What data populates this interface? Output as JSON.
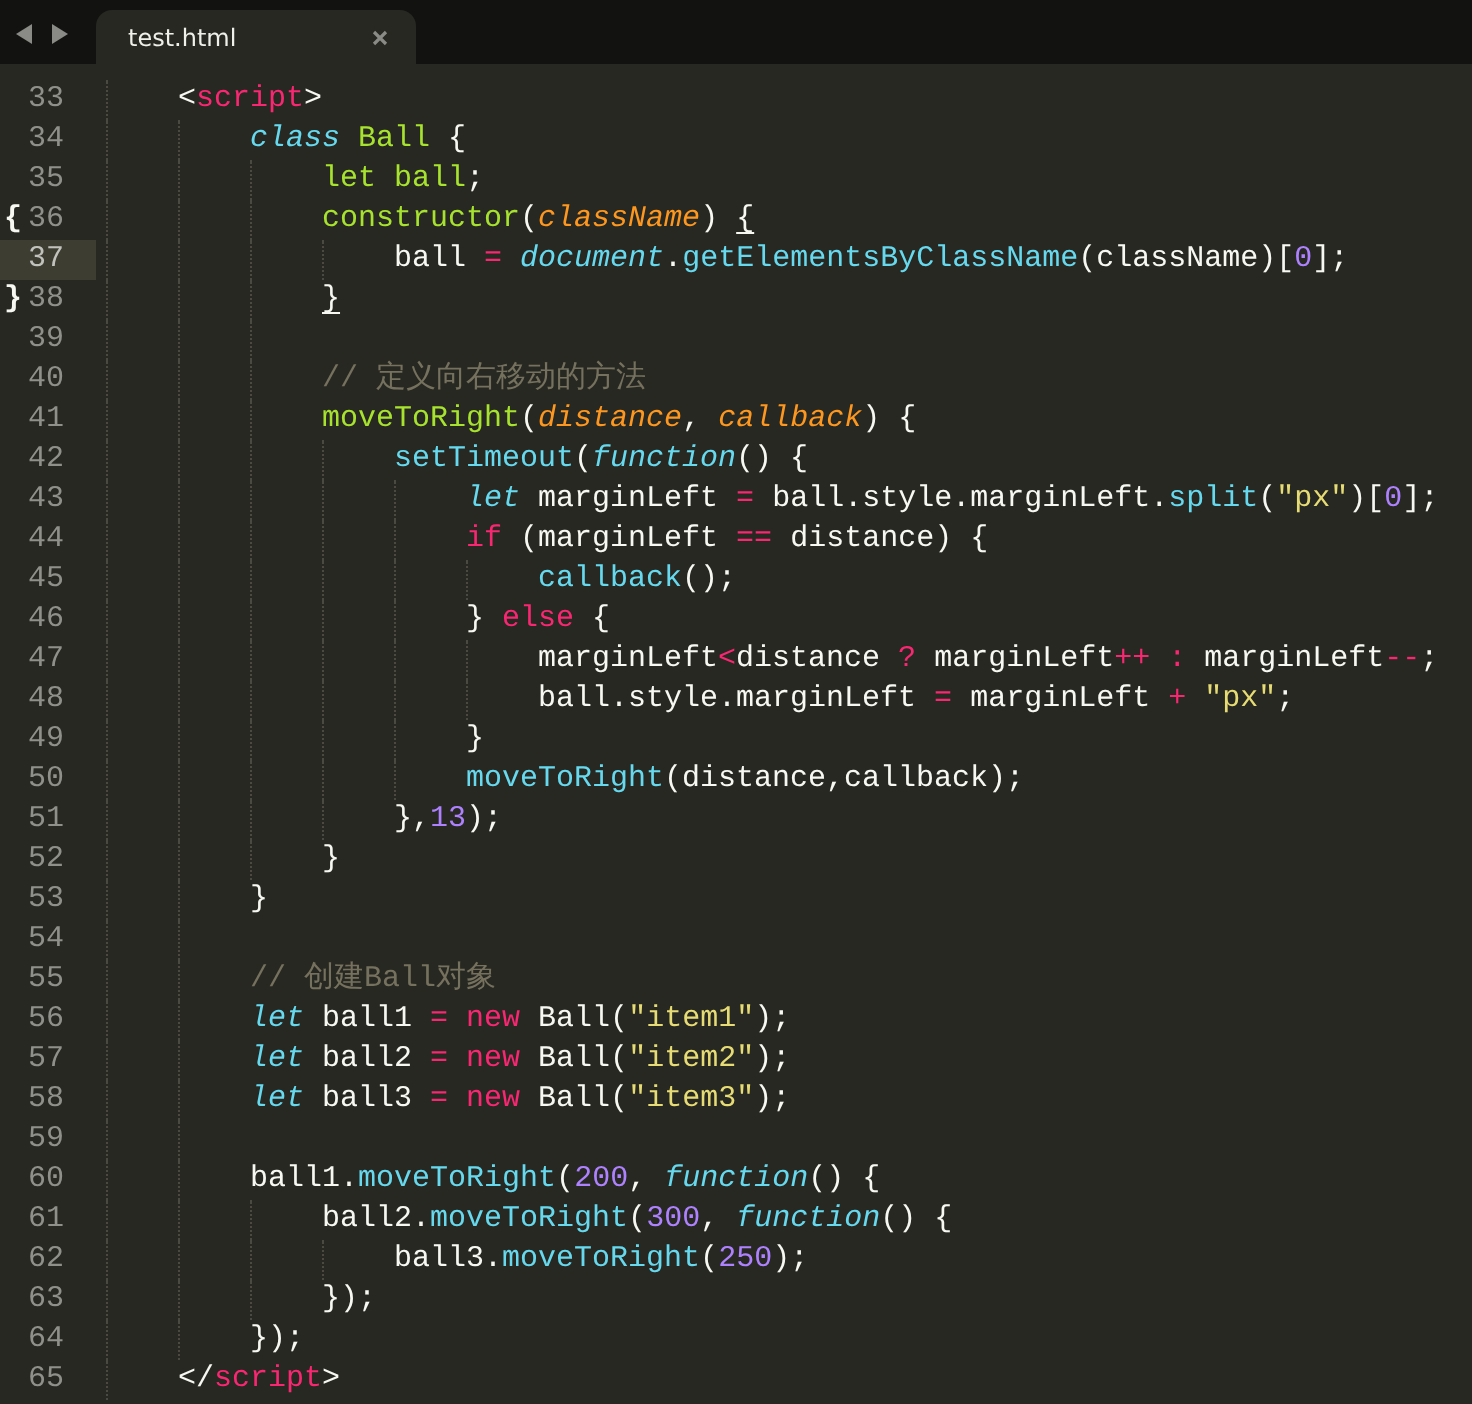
{
  "tabs": [
    {
      "label": "test.html",
      "selected": true
    }
  ],
  "lines": [
    {
      "number": "33",
      "current": false,
      "tokens": [
        {
          "kind": "plain",
          "text": "<"
        },
        {
          "kind": "keyword",
          "text": "script"
        },
        {
          "kind": "plain",
          "text": ">"
        }
      ],
      "children": [
        {
          "number": "34",
          "current": false,
          "tokens": [
            {
              "kind": "storage",
              "text": "class "
            },
            {
              "kind": "entity",
              "text": "Ball"
            },
            {
              "kind": "plain",
              "text": " {"
            }
          ],
          "children": [
            {
              "number": "35",
              "current": false,
              "tokens": [
                {
                  "kind": "entity",
                  "text": "let ball"
                },
                {
                  "kind": "plain",
                  "text": ";"
                }
              ]
            },
            {
              "number": "36",
              "current": false,
              "gutter_mark": "{",
              "tokens": [
                {
                  "kind": "entity",
                  "text": "constructor"
                },
                {
                  "kind": "plain",
                  "text": "("
                },
                {
                  "kind": "param",
                  "text": "className"
                },
                {
                  "kind": "plain",
                  "text": ") "
                },
                {
                  "kind": "plain",
                  "text": "{",
                  "matched": true
                }
              ],
              "children": [
                {
                  "number": "37",
                  "current": true,
                  "tokens": [
                    {
                      "kind": "plain",
                      "text": "ball "
                    },
                    {
                      "kind": "keyword",
                      "text": "= "
                    },
                    {
                      "kind": "storage",
                      "text": "document"
                    },
                    {
                      "kind": "plain",
                      "text": "."
                    },
                    {
                      "kind": "support",
                      "text": "getElementsByClassName"
                    },
                    {
                      "kind": "plain",
                      "text": "(className)["
                    },
                    {
                      "kind": "number",
                      "text": "0"
                    },
                    {
                      "kind": "plain",
                      "text": "];"
                    }
                  ]
                }
              ]
            },
            {
              "number": "38",
              "current": false,
              "gutter_mark": "}",
              "tokens": [
                {
                  "kind": "plain",
                  "text": "}",
                  "matched": true
                }
              ]
            },
            {
              "number": "39",
              "current": false
            },
            {
              "number": "40",
              "current": false,
              "tokens": [
                {
                  "kind": "comment",
                  "text": "// 定义向右移动的方法"
                }
              ]
            },
            {
              "number": "41",
              "current": false,
              "tokens": [
                {
                  "kind": "entity",
                  "text": "moveToRight"
                },
                {
                  "kind": "plain",
                  "text": "("
                },
                {
                  "kind": "param",
                  "text": "distance"
                },
                {
                  "kind": "plain",
                  "text": ", "
                },
                {
                  "kind": "param",
                  "text": "callback"
                },
                {
                  "kind": "plain",
                  "text": ") {"
                }
              ],
              "children": [
                {
                  "number": "42",
                  "current": false,
                  "tokens": [
                    {
                      "kind": "support",
                      "text": "setTimeout"
                    },
                    {
                      "kind": "plain",
                      "text": "("
                    },
                    {
                      "kind": "storage",
                      "text": "function"
                    },
                    {
                      "kind": "plain",
                      "text": "() {"
                    }
                  ],
                  "children": [
                    {
                      "number": "43",
                      "current": false,
                      "tokens": [
                        {
                          "kind": "storage",
                          "text": "let"
                        },
                        {
                          "kind": "plain",
                          "text": " marginLeft "
                        },
                        {
                          "kind": "keyword",
                          "text": "="
                        },
                        {
                          "kind": "plain",
                          "text": " ball.style.marginLeft."
                        },
                        {
                          "kind": "support",
                          "text": "split"
                        },
                        {
                          "kind": "plain",
                          "text": "("
                        },
                        {
                          "kind": "string",
                          "text": "\"px\""
                        },
                        {
                          "kind": "plain",
                          "text": ")["
                        },
                        {
                          "kind": "number",
                          "text": "0"
                        },
                        {
                          "kind": "plain",
                          "text": "];"
                        }
                      ]
                    },
                    {
                      "number": "44",
                      "current": false,
                      "tokens": [
                        {
                          "kind": "keyword",
                          "text": "if"
                        },
                        {
                          "kind": "plain",
                          "text": " (marginLeft "
                        },
                        {
                          "kind": "keyword",
                          "text": "=="
                        },
                        {
                          "kind": "plain",
                          "text": " distance) {"
                        }
                      ],
                      "children": [
                        {
                          "number": "45",
                          "current": false,
                          "tokens": [
                            {
                              "kind": "support",
                              "text": "callback"
                            },
                            {
                              "kind": "plain",
                              "text": "();"
                            }
                          ]
                        }
                      ]
                    },
                    {
                      "number": "46",
                      "current": false,
                      "tokens": [
                        {
                          "kind": "plain",
                          "text": "} "
                        },
                        {
                          "kind": "keyword",
                          "text": "else"
                        },
                        {
                          "kind": "plain",
                          "text": " {"
                        }
                      ],
                      "children": [
                        {
                          "number": "47",
                          "current": false,
                          "tokens": [
                            {
                              "kind": "plain",
                              "text": "marginLeft"
                            },
                            {
                              "kind": "keyword",
                              "text": "<"
                            },
                            {
                              "kind": "plain",
                              "text": "distance "
                            },
                            {
                              "kind": "keyword",
                              "text": "?"
                            },
                            {
                              "kind": "plain",
                              "text": " marginLeft"
                            },
                            {
                              "kind": "keyword",
                              "text": "++ :"
                            },
                            {
                              "kind": "plain",
                              "text": " marginLeft"
                            },
                            {
                              "kind": "keyword",
                              "text": "--"
                            },
                            {
                              "kind": "plain",
                              "text": ";"
                            }
                          ]
                        },
                        {
                          "number": "48",
                          "current": false,
                          "tokens": [
                            {
                              "kind": "plain",
                              "text": "ball.style.marginLeft "
                            },
                            {
                              "kind": "keyword",
                              "text": "="
                            },
                            {
                              "kind": "plain",
                              "text": " marginLeft "
                            },
                            {
                              "kind": "keyword",
                              "text": "+ "
                            },
                            {
                              "kind": "string",
                              "text": "\"px\""
                            },
                            {
                              "kind": "plain",
                              "text": ";"
                            }
                          ]
                        }
                      ]
                    },
                    {
                      "number": "49",
                      "current": false,
                      "tokens": [
                        {
                          "kind": "plain",
                          "text": "}"
                        }
                      ]
                    },
                    {
                      "number": "50",
                      "current": false,
                      "tokens": [
                        {
                          "kind": "support",
                          "text": "moveToRight"
                        },
                        {
                          "kind": "plain",
                          "text": "(distance,callback);"
                        }
                      ]
                    }
                  ]
                },
                {
                  "number": "51",
                  "current": false,
                  "tokens": [
                    {
                      "kind": "plain",
                      "text": "},"
                    },
                    {
                      "kind": "number",
                      "text": "13"
                    },
                    {
                      "kind": "plain",
                      "text": ");"
                    }
                  ]
                }
              ]
            },
            {
              "number": "52",
              "current": false,
              "tokens": [
                {
                  "kind": "plain",
                  "text": "}"
                }
              ]
            }
          ]
        },
        {
          "number": "53",
          "current": false,
          "tokens": [
            {
              "kind": "plain",
              "text": "}"
            }
          ]
        },
        {
          "number": "54",
          "current": false
        },
        {
          "number": "55",
          "current": false,
          "tokens": [
            {
              "kind": "comment",
              "text": "// 创建Ball对象"
            }
          ]
        },
        {
          "number": "56",
          "current": false,
          "tokens": [
            {
              "kind": "storage",
              "text": "let"
            },
            {
              "kind": "plain",
              "text": " ball1 "
            },
            {
              "kind": "keyword",
              "text": "= new"
            },
            {
              "kind": "plain",
              "text": " Ball("
            },
            {
              "kind": "string",
              "text": "\"item1\""
            },
            {
              "kind": "plain",
              "text": ");"
            }
          ]
        },
        {
          "number": "57",
          "current": false,
          "tokens": [
            {
              "kind": "storage",
              "text": "let"
            },
            {
              "kind": "plain",
              "text": " ball2 "
            },
            {
              "kind": "keyword",
              "text": "= new"
            },
            {
              "kind": "plain",
              "text": " Ball("
            },
            {
              "kind": "string",
              "text": "\"item2\""
            },
            {
              "kind": "plain",
              "text": ");"
            }
          ]
        },
        {
          "number": "58",
          "current": false,
          "tokens": [
            {
              "kind": "storage",
              "text": "let"
            },
            {
              "kind": "plain",
              "text": " ball3 "
            },
            {
              "kind": "keyword",
              "text": "= new"
            },
            {
              "kind": "plain",
              "text": " Ball("
            },
            {
              "kind": "string",
              "text": "\"item3\""
            },
            {
              "kind": "plain",
              "text": ");"
            }
          ]
        },
        {
          "number": "59",
          "current": false
        },
        {
          "number": "60",
          "current": false,
          "tokens": [
            {
              "kind": "plain",
              "text": "ball1."
            },
            {
              "kind": "support",
              "text": "moveToRight"
            },
            {
              "kind": "plain",
              "text": "("
            },
            {
              "kind": "number",
              "text": "200"
            },
            {
              "kind": "plain",
              "text": ", "
            },
            {
              "kind": "storage",
              "text": "function"
            },
            {
              "kind": "plain",
              "text": "() {"
            }
          ],
          "children": [
            {
              "number": "61",
              "current": false,
              "tokens": [
                {
                  "kind": "plain",
                  "text": "ball2."
                },
                {
                  "kind": "support",
                  "text": "moveToRight"
                },
                {
                  "kind": "plain",
                  "text": "("
                },
                {
                  "kind": "number",
                  "text": "300"
                },
                {
                  "kind": "plain",
                  "text": ", "
                },
                {
                  "kind": "storage",
                  "text": "function"
                },
                {
                  "kind": "plain",
                  "text": "() {"
                }
              ],
              "children": [
                {
                  "number": "62",
                  "current": false,
                  "tokens": [
                    {
                      "kind": "plain",
                      "text": "ball3."
                    },
                    {
                      "kind": "support",
                      "text": "moveToRight"
                    },
                    {
                      "kind": "plain",
                      "text": "("
                    },
                    {
                      "kind": "number",
                      "text": "250"
                    },
                    {
                      "kind": "plain",
                      "text": ");"
                    }
                  ]
                }
              ]
            },
            {
              "number": "63",
              "current": false,
              "tokens": [
                {
                  "kind": "plain",
                  "text": "});"
                }
              ]
            }
          ]
        },
        {
          "number": "64",
          "current": false,
          "tokens": [
            {
              "kind": "plain",
              "text": "});"
            }
          ]
        }
      ]
    },
    {
      "number": "65",
      "current": false,
      "tokens": [
        {
          "kind": "plain",
          "text": "</"
        },
        {
          "kind": "keyword",
          "text": "script"
        },
        {
          "kind": "plain",
          "text": ">"
        }
      ]
    }
  ]
}
